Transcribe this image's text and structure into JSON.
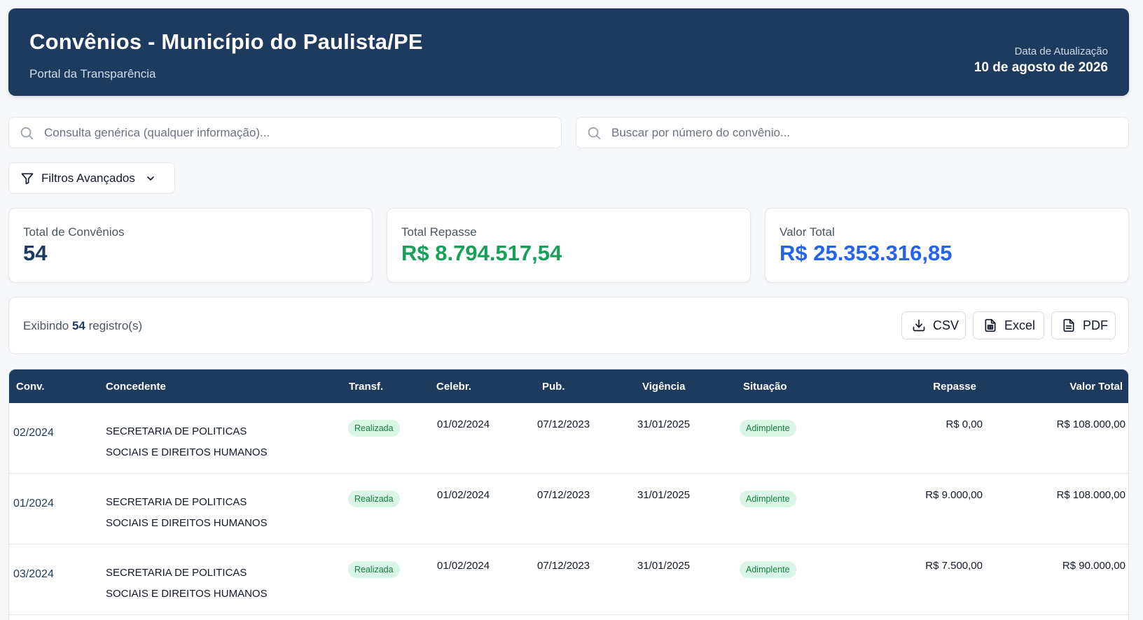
{
  "header": {
    "title": "Convênios - Município do Paulista/PE",
    "subtitle": "Portal da Transparência",
    "update_label": "Data de Atualização",
    "update_date": "10 de agosto de 2026"
  },
  "search": {
    "generic_placeholder": "Consulta genérica (qualquer informação)...",
    "number_placeholder": "Buscar por número do convênio..."
  },
  "filters": {
    "label": "Filtros Avançados"
  },
  "stats": {
    "total_label": "Total de Convênios",
    "total_value": "54",
    "repasse_label": "Total Repasse",
    "repasse_value": "R$ 8.794.517,54",
    "valor_label": "Valor Total",
    "valor_value": "R$ 25.353.316,85"
  },
  "toolbar": {
    "count_prefix": "Exibindo",
    "count_value": "54",
    "count_suffix": "registro(s)",
    "csv_label": "CSV",
    "excel_label": "Excel",
    "pdf_label": "PDF"
  },
  "table": {
    "headers": {
      "conv": "Conv.",
      "concedente": "Concedente",
      "transf": "Transf.",
      "celebr": "Celebr.",
      "pub": "Pub.",
      "vigencia": "Vigência",
      "situacao": "Situação",
      "repasse": "Repasse",
      "valor_total": "Valor Total"
    },
    "rows": [
      {
        "conv": "02/2024",
        "concedente_1": "SECRETARIA DE POLITICAS",
        "concedente_2": "SOCIAIS E DIREITOS HUMANOS",
        "transf": "Realizada",
        "celebr": "01/02/2024",
        "pub": "07/12/2023",
        "vigencia": "31/01/2025",
        "situacao": "Adimplente",
        "repasse": "R$ 0,00",
        "valor_total": "R$ 108.000,00"
      },
      {
        "conv": "01/2024",
        "concedente_1": "SECRETARIA DE POLITICAS",
        "concedente_2": "SOCIAIS E DIREITOS HUMANOS",
        "transf": "Realizada",
        "celebr": "01/02/2024",
        "pub": "07/12/2023",
        "vigencia": "31/01/2025",
        "situacao": "Adimplente",
        "repasse": "R$ 9.000,00",
        "valor_total": "R$ 108.000,00"
      },
      {
        "conv": "03/2024",
        "concedente_1": "SECRETARIA DE POLITICAS",
        "concedente_2": "SOCIAIS E DIREITOS HUMANOS",
        "transf": "Realizada",
        "celebr": "01/02/2024",
        "pub": "07/12/2023",
        "vigencia": "31/01/2025",
        "situacao": "Adimplente",
        "repasse": "R$ 7.500,00",
        "valor_total": "R$ 90.000,00"
      }
    ]
  },
  "colors": {
    "primary": "#1e3a5f",
    "repasse_green": "#16a05a",
    "valor_blue": "#2563eb",
    "badge_bg": "#d9f5e5",
    "badge_text": "#15803d"
  },
  "icons": {
    "search": "search-icon",
    "filter": "filter-icon",
    "chevron": "chevron-down-icon",
    "csv": "download-icon",
    "excel": "spreadsheet-icon",
    "pdf": "document-icon"
  }
}
